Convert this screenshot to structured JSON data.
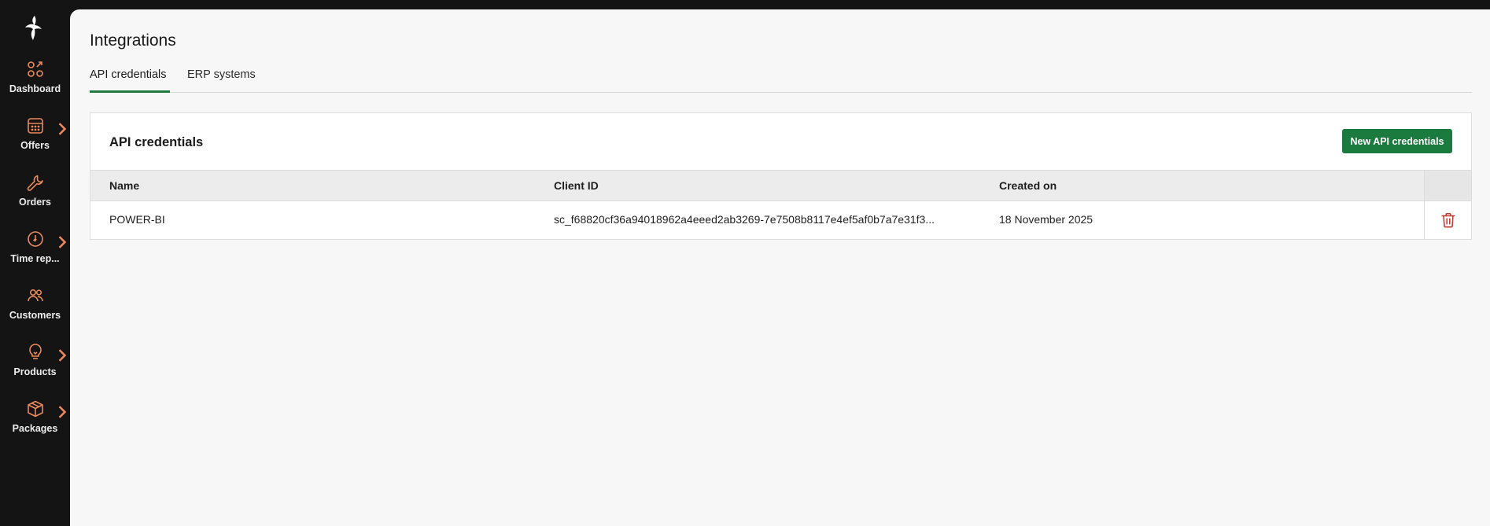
{
  "app": {
    "accent_color": "#1b7a3e",
    "icon_color": "#e98a5a"
  },
  "sidebar": {
    "items": [
      {
        "label": "Dashboard",
        "icon": "dashboard-icon",
        "has_submenu": false
      },
      {
        "label": "Offers",
        "icon": "calculator-icon",
        "has_submenu": true
      },
      {
        "label": "Orders",
        "icon": "wrench-icon",
        "has_submenu": false
      },
      {
        "label": "Time rep...",
        "icon": "clock-icon",
        "has_submenu": true
      },
      {
        "label": "Customers",
        "icon": "users-icon",
        "has_submenu": false
      },
      {
        "label": "Products",
        "icon": "lightbulb-icon",
        "has_submenu": true
      },
      {
        "label": "Packages",
        "icon": "box-icon",
        "has_submenu": true
      }
    ]
  },
  "page": {
    "title": "Integrations",
    "tabs": [
      {
        "label": "API credentials",
        "active": true
      },
      {
        "label": "ERP systems",
        "active": false
      }
    ]
  },
  "card": {
    "title": "API credentials",
    "new_button_label": "New API credentials",
    "table": {
      "columns": [
        "Name",
        "Client ID",
        "Created on"
      ],
      "rows": [
        {
          "name": "POWER-BI",
          "client_id": "sc_f68820cf36a94018962a4eeed2ab3269-7e7508b8117e4ef5af0b7a7e31f3...",
          "created_on": "18 November 2025"
        }
      ]
    }
  }
}
